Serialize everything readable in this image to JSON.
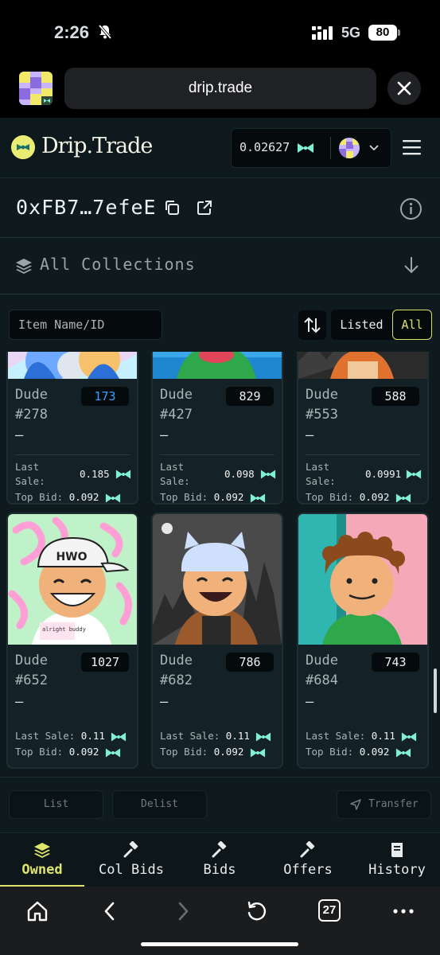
{
  "status": {
    "time": "2:26",
    "network": "5G",
    "battery": "80"
  },
  "browser": {
    "url": "drip.trade",
    "tab_count": "27"
  },
  "header": {
    "brand": "Drip.Trade",
    "balance": "0.02627"
  },
  "profile": {
    "address": "0xFB7…7efeE"
  },
  "collections": {
    "label": "All Collections"
  },
  "filters": {
    "search_placeholder": "Item Name/ID",
    "listed_label": "Listed",
    "all_label": "All"
  },
  "items": [
    {
      "name": "Dude",
      "id": "#278",
      "rank": "173",
      "rank_color": "#3aa0ff",
      "price": "–",
      "last_sale_label": "Last Sale:",
      "last_sale": "0.185",
      "top_bid_label": "Top Bid:",
      "top_bid": "0.092"
    },
    {
      "name": "Dude",
      "id": "#427",
      "rank": "829",
      "rank_color": "#f0f0f0",
      "price": "–",
      "last_sale_label": "Last Sale:",
      "last_sale": "0.098",
      "top_bid_label": "Top Bid:",
      "top_bid": "0.092"
    },
    {
      "name": "Dude",
      "id": "#553",
      "rank": "588",
      "rank_color": "#f0f0f0",
      "price": "–",
      "last_sale_label": "Last Sale:",
      "last_sale": "0.0991",
      "top_bid_label": "Top Bid:",
      "top_bid": "0.092"
    },
    {
      "name": "Dude",
      "id": "#652",
      "rank": "1027",
      "rank_color": "#f0f0f0",
      "price": "–",
      "last_sale_label": "Last Sale:",
      "last_sale": "0.11",
      "top_bid_label": "Top Bid:",
      "top_bid": "0.092",
      "art_cap": "HWO",
      "art_shirt": "alright buddy"
    },
    {
      "name": "Dude",
      "id": "#682",
      "rank": "786",
      "rank_color": "#f0f0f0",
      "price": "–",
      "last_sale_label": "Last Sale:",
      "last_sale": "0.11",
      "top_bid_label": "Top Bid:",
      "top_bid": "0.092"
    },
    {
      "name": "Dude",
      "id": "#684",
      "rank": "743",
      "rank_color": "#f0f0f0",
      "price": "–",
      "last_sale_label": "Last Sale:",
      "last_sale": "0.11",
      "top_bid_label": "Top Bid:",
      "top_bid": "0.092"
    }
  ],
  "actions": {
    "list": "List",
    "delist": "Delist",
    "transfer": "Transfer"
  },
  "tabs": [
    {
      "label": "Owned",
      "icon": "layers-icon",
      "active": true
    },
    {
      "label": "Col Bids",
      "icon": "gavel-icon"
    },
    {
      "label": "Bids",
      "icon": "gavel-icon"
    },
    {
      "label": "Offers",
      "icon": "gavel-icon"
    },
    {
      "label": "History",
      "icon": "book-icon"
    }
  ],
  "colors": {
    "accent": "#dfe56b",
    "bow": "#7ff0d6",
    "background": "#0f1a1e"
  }
}
